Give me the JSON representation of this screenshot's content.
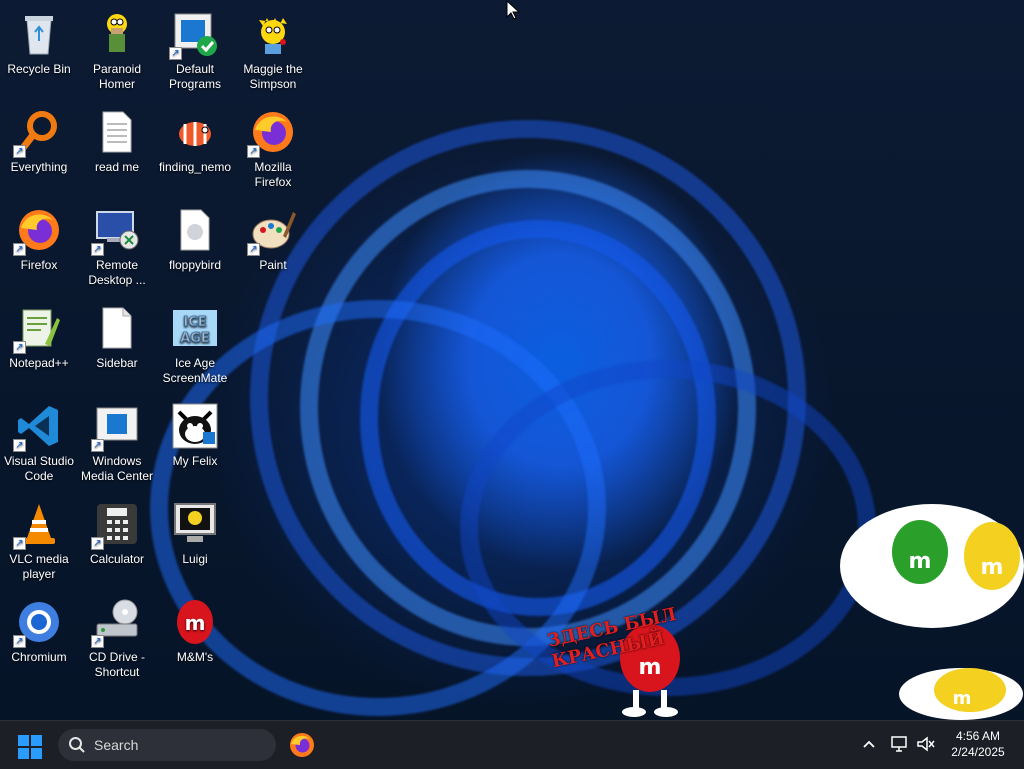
{
  "desktop": {
    "icons": [
      {
        "label": "Recycle Bin",
        "icon": "recycle-bin-icon",
        "shortcut": false
      },
      {
        "label": "Paranoid Homer",
        "icon": "homer-icon",
        "shortcut": false
      },
      {
        "label": "Default Programs",
        "icon": "default-programs-icon",
        "shortcut": true
      },
      {
        "label": "Maggie the Simpson",
        "icon": "maggie-icon",
        "shortcut": false
      },
      {
        "label": "Everything",
        "icon": "everything-search-icon",
        "shortcut": true
      },
      {
        "label": "read me",
        "icon": "text-file-icon",
        "shortcut": false
      },
      {
        "label": "finding_nemo",
        "icon": "nemo-icon",
        "shortcut": false
      },
      {
        "label": "Mozilla Firefox",
        "icon": "firefox-icon",
        "shortcut": true
      },
      {
        "label": "Firefox",
        "icon": "firefox-icon",
        "shortcut": true
      },
      {
        "label": "Remote Desktop ...",
        "icon": "remote-desktop-icon",
        "shortcut": true
      },
      {
        "label": "floppybird",
        "icon": "generic-file-icon",
        "shortcut": false
      },
      {
        "label": "Paint",
        "icon": "paint-icon",
        "shortcut": true
      },
      {
        "label": "Notepad++",
        "icon": "notepad-plus-plus-icon",
        "shortcut": true
      },
      {
        "label": "Sidebar",
        "icon": "blank-file-icon",
        "shortcut": false
      },
      {
        "label": "Ice Age ScreenMate",
        "icon": "ice-age-icon",
        "shortcut": false
      },
      {
        "label": "Visual Studio Code",
        "icon": "vscode-icon",
        "shortcut": true
      },
      {
        "label": "Windows Media Center",
        "icon": "media-center-icon",
        "shortcut": true
      },
      {
        "label": "My Felix",
        "icon": "felix-cat-icon",
        "shortcut": false
      },
      {
        "label": "VLC media player",
        "icon": "vlc-icon",
        "shortcut": true
      },
      {
        "label": "Calculator",
        "icon": "calculator-icon",
        "shortcut": true
      },
      {
        "label": "Luigi",
        "icon": "luigi-monitor-icon",
        "shortcut": false
      },
      {
        "label": "Chromium",
        "icon": "chromium-icon",
        "shortcut": true
      },
      {
        "label": "CD Drive - Shortcut",
        "icon": "cd-drive-icon",
        "shortcut": true
      },
      {
        "label": "M&M's",
        "icon": "red-mm-icon",
        "shortcut": false
      }
    ],
    "overlay_text": "ЗДЕСЬ БЫЛ КРАСНЫЙ"
  },
  "taskbar": {
    "search_placeholder": "Search",
    "pinned": [
      {
        "name": "Firefox",
        "icon": "firefox-icon"
      }
    ],
    "clock": {
      "time": "4:56 AM",
      "date": "2/24/2025"
    }
  },
  "colors": {
    "taskbar_bg": "#1c1f26",
    "wallpaper_accent": "#1456d6",
    "start_blue": "#0a84ff"
  }
}
